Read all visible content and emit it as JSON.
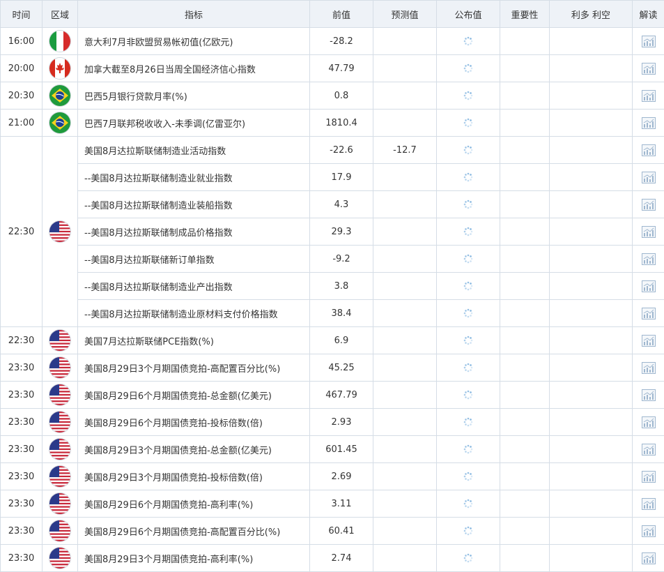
{
  "headers": [
    "时间",
    "区域",
    "指标",
    "前值",
    "预测值",
    "公布值",
    "重要性",
    "利多 利空",
    "解读"
  ],
  "colors": {
    "header_bg": "#eef2f7",
    "border": "#d5dde6",
    "spinner": "#7fb3df",
    "icon": "#9fb7cf"
  },
  "rows": [
    {
      "time": "16:00",
      "flag": "italy-flag",
      "indicator": "意大利7月非欧盟贸易帐初值(亿欧元)",
      "prev": "-28.2",
      "forecast": "",
      "actual": ""
    },
    {
      "time": "20:00",
      "flag": "canada-flag",
      "indicator": "加拿大截至8月26日当周全国经济信心指数",
      "prev": "47.79",
      "forecast": "",
      "actual": ""
    },
    {
      "time": "20:30",
      "flag": "brazil-flag",
      "indicator": "巴西5月银行贷款月率(%)",
      "prev": "0.8",
      "forecast": "",
      "actual": ""
    },
    {
      "time": "21:00",
      "flag": "brazil-flag",
      "indicator": "巴西7月联邦税收收入-未季调(亿雷亚尔)",
      "prev": "1810.4",
      "forecast": "",
      "actual": ""
    },
    {
      "time": "22:30",
      "flag": "usa-flag",
      "group": 7,
      "indicator": "美国8月达拉斯联储制造业活动指数",
      "prev": "-22.6",
      "forecast": "-12.7",
      "actual": ""
    },
    {
      "indicator": "--美国8月达拉斯联储制造业就业指数",
      "prev": "17.9",
      "forecast": "",
      "actual": ""
    },
    {
      "indicator": "--美国8月达拉斯联储制造业装船指数",
      "prev": "4.3",
      "forecast": "",
      "actual": ""
    },
    {
      "indicator": "--美国8月达拉斯联储制成品价格指数",
      "prev": "29.3",
      "forecast": "",
      "actual": ""
    },
    {
      "indicator": "--美国8月达拉斯联储新订单指数",
      "prev": "-9.2",
      "forecast": "",
      "actual": ""
    },
    {
      "indicator": "--美国8月达拉斯联储制造业产出指数",
      "prev": "3.8",
      "forecast": "",
      "actual": ""
    },
    {
      "indicator": "--美国8月达拉斯联储制造业原材料支付价格指数",
      "prev": "38.4",
      "forecast": "",
      "actual": ""
    },
    {
      "time": "22:30",
      "flag": "usa-flag",
      "indicator": "美国7月达拉斯联储PCE指数(%)",
      "prev": "6.9",
      "forecast": "",
      "actual": ""
    },
    {
      "time": "23:30",
      "flag": "usa-flag",
      "indicator": "美国8月29日3个月期国债竞拍-高配置百分比(%)",
      "prev": "45.25",
      "forecast": "",
      "actual": ""
    },
    {
      "time": "23:30",
      "flag": "usa-flag",
      "indicator": "美国8月29日6个月期国债竞拍-总金额(亿美元)",
      "prev": "467.79",
      "forecast": "",
      "actual": ""
    },
    {
      "time": "23:30",
      "flag": "usa-flag",
      "indicator": "美国8月29日6个月期国债竞拍-投标倍数(倍)",
      "prev": "2.93",
      "forecast": "",
      "actual": ""
    },
    {
      "time": "23:30",
      "flag": "usa-flag",
      "indicator": "美国8月29日3个月期国债竞拍-总金额(亿美元)",
      "prev": "601.45",
      "forecast": "",
      "actual": ""
    },
    {
      "time": "23:30",
      "flag": "usa-flag",
      "indicator": "美国8月29日3个月期国债竞拍-投标倍数(倍)",
      "prev": "2.69",
      "forecast": "",
      "actual": ""
    },
    {
      "time": "23:30",
      "flag": "usa-flag",
      "indicator": "美国8月29日6个月期国债竞拍-高利率(%)",
      "prev": "3.11",
      "forecast": "",
      "actual": ""
    },
    {
      "time": "23:30",
      "flag": "usa-flag",
      "indicator": "美国8月29日6个月期国债竞拍-高配置百分比(%)",
      "prev": "60.41",
      "forecast": "",
      "actual": ""
    },
    {
      "time": "23:30",
      "flag": "usa-flag",
      "indicator": "美国8月29日3个月期国债竞拍-高利率(%)",
      "prev": "2.74",
      "forecast": "",
      "actual": ""
    }
  ]
}
